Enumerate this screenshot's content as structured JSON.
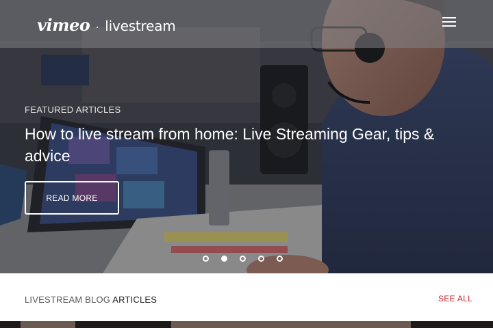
{
  "header": {
    "brand_primary": "vimeo",
    "brand_separator": "·",
    "brand_secondary": "livestream",
    "menu_icon": "hamburger-menu-icon"
  },
  "hero": {
    "eyebrow": "FEATURED ARTICLES",
    "headline": "How to live stream from home: Live Streaming Gear, tips & advice",
    "cta_label": "READ MORE",
    "slides": {
      "count": 5,
      "active_index": 1
    }
  },
  "blog_section": {
    "title_prefix": "LIVESTREAM BLOG",
    "title_emphasis": "ARTICLES",
    "see_all_label": "SEE ALL",
    "accent_color": "#c0272d"
  }
}
